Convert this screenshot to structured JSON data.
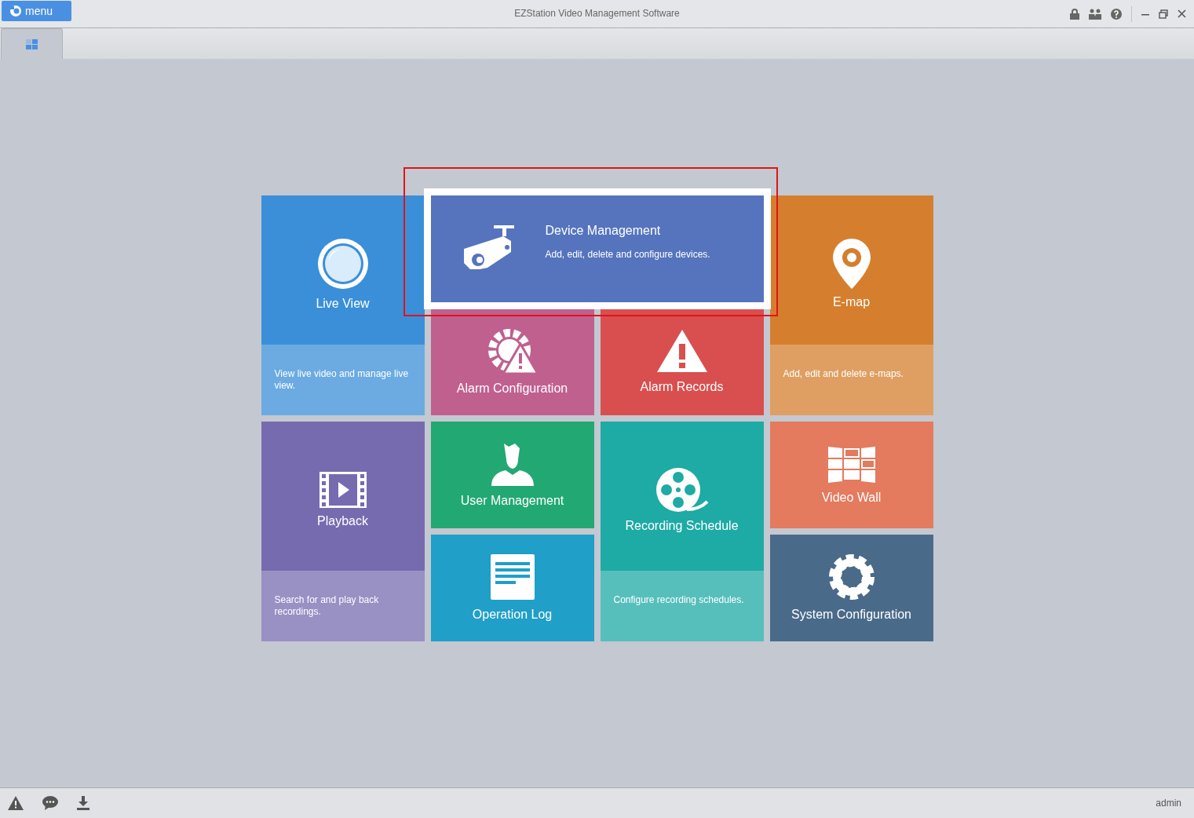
{
  "window": {
    "title": "EZStation Video Management Software",
    "menu_button": "menu"
  },
  "tabs": [
    {
      "selected": true
    }
  ],
  "tiles": [
    {
      "kind": "tall",
      "title": "Live View",
      "description": "View live video and manage live view.",
      "color": "#3a8fd8",
      "selected": false
    },
    {
      "kind": "wide",
      "title": "Device Management",
      "description": "Add, edit, delete and configure devices.",
      "color": "#5574bd",
      "selected": true
    },
    {
      "kind": "tall",
      "title": "E-map",
      "description": "Add, edit and delete e-maps.",
      "color": "#d57f2e",
      "selected": false
    },
    {
      "kind": "small",
      "title": "Alarm Configuration",
      "color": "#c0608f",
      "selected": false
    },
    {
      "kind": "small",
      "title": "Alarm Records",
      "color": "#d94f4f",
      "selected": false
    },
    {
      "kind": "tall",
      "title": "Playback",
      "description": "Search for and play back recordings.",
      "color": "#776bb0",
      "selected": false
    },
    {
      "kind": "small",
      "title": "User Management",
      "color": "#22a873",
      "selected": false
    },
    {
      "kind": "tall",
      "title": "Recording Schedule",
      "description": "Configure recording schedules.",
      "color": "#1eaaa5",
      "selected": false
    },
    {
      "kind": "small",
      "title": "Video Wall",
      "color": "#e47a5e",
      "selected": false
    },
    {
      "kind": "small",
      "title": "Operation Log",
      "color": "#209fc8",
      "selected": false
    },
    {
      "kind": "small",
      "title": "System Configuration",
      "color": "#4a6a8a",
      "selected": false
    }
  ],
  "status_bar": {
    "user": "admin"
  }
}
